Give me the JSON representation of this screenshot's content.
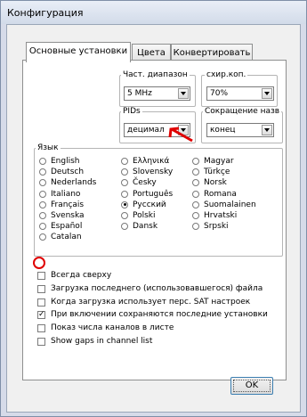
{
  "window": {
    "title": "Конфигурация"
  },
  "tabs": [
    {
      "label": "Основные установки",
      "active": true
    },
    {
      "label": "Цвета",
      "active": false
    },
    {
      "label": "Конвертировать",
      "active": false
    }
  ],
  "settings": {
    "freq_range": {
      "label": "Част. диапазон",
      "value": "5 MHz"
    },
    "scan_speed": {
      "label": "схир.коп.",
      "value": "70%"
    },
    "pids": {
      "label": "PIDs",
      "value": "децимал"
    },
    "abbrev": {
      "label": "Сокращение назв",
      "value": "конец"
    }
  },
  "language": {
    "label": "Язык",
    "selected": "Русский",
    "options": [
      "English",
      "Deutsch",
      "Nederlands",
      "Italiano",
      "Français",
      "Svenska",
      "Español",
      "Catalan",
      "Ελληνικά",
      "Slovensky",
      "Česky",
      "Português",
      "Русский",
      "Polski",
      "Dansk",
      "Magyar",
      "Türkçe",
      "Norsk",
      "Romana",
      "Suomalainen",
      "Hrvatski",
      "Srpski"
    ]
  },
  "options": [
    {
      "label": "Всегда сверху",
      "checked": false
    },
    {
      "label": "Загрузка последнего (использовавшегося) файла",
      "checked": false
    },
    {
      "label": "Когда загрузка использует перс. SAT настроек",
      "checked": false
    },
    {
      "label": "При включении сохраняются последние установки",
      "checked": true
    },
    {
      "label": " Показ числа каналов в листе",
      "checked": false
    },
    {
      "label": "Show gaps in channel list",
      "checked": false
    }
  ],
  "ok_label": "OK",
  "annotation_color": "#e00000",
  "icons": {
    "dropdown": "chevron-down-icon",
    "annotation_arrow": "red-arrow-icon",
    "annotation_circle": "red-circle-icon"
  }
}
